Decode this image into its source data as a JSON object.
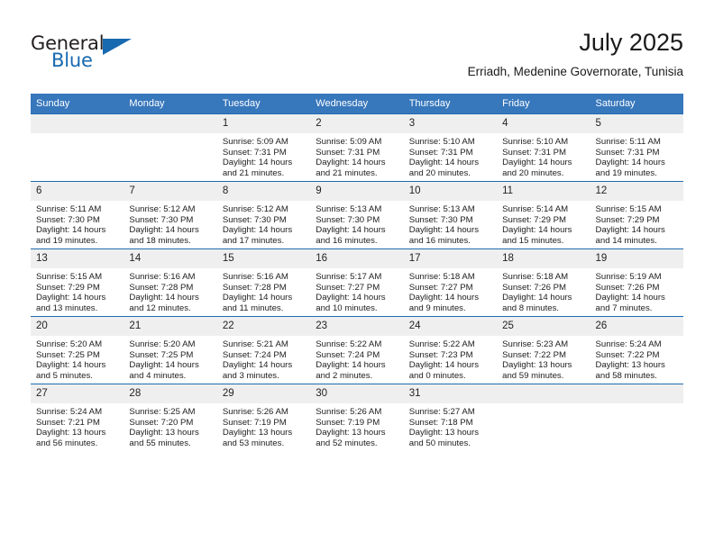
{
  "logo": {
    "line1": "General",
    "line2": "Blue",
    "triangle_icon": "triangle-icon",
    "color_text": "#231f20",
    "color_blue": "#1769b0"
  },
  "header": {
    "title": "July 2025",
    "subtitle": "Erriadh, Medenine Governorate, Tunisia"
  },
  "theme": {
    "header_bg": "#3777bc",
    "row_divider": "#1f6cb0",
    "daynum_bg": "#efefef",
    "text": "#1d1d1d"
  },
  "calendar": {
    "weekday_headers": [
      "Sunday",
      "Monday",
      "Tuesday",
      "Wednesday",
      "Thursday",
      "Friday",
      "Saturday"
    ],
    "labels": {
      "sunrise": "Sunrise:",
      "sunset": "Sunset:",
      "daylight": "Daylight:"
    },
    "weeks": [
      [
        {
          "day": ""
        },
        {
          "day": ""
        },
        {
          "day": "1",
          "sunrise": "Sunrise: 5:09 AM",
          "sunset": "Sunset: 7:31 PM",
          "daylight": "Daylight: 14 hours and 21 minutes."
        },
        {
          "day": "2",
          "sunrise": "Sunrise: 5:09 AM",
          "sunset": "Sunset: 7:31 PM",
          "daylight": "Daylight: 14 hours and 21 minutes."
        },
        {
          "day": "3",
          "sunrise": "Sunrise: 5:10 AM",
          "sunset": "Sunset: 7:31 PM",
          "daylight": "Daylight: 14 hours and 20 minutes."
        },
        {
          "day": "4",
          "sunrise": "Sunrise: 5:10 AM",
          "sunset": "Sunset: 7:31 PM",
          "daylight": "Daylight: 14 hours and 20 minutes."
        },
        {
          "day": "5",
          "sunrise": "Sunrise: 5:11 AM",
          "sunset": "Sunset: 7:31 PM",
          "daylight": "Daylight: 14 hours and 19 minutes."
        }
      ],
      [
        {
          "day": "6",
          "sunrise": "Sunrise: 5:11 AM",
          "sunset": "Sunset: 7:30 PM",
          "daylight": "Daylight: 14 hours and 19 minutes."
        },
        {
          "day": "7",
          "sunrise": "Sunrise: 5:12 AM",
          "sunset": "Sunset: 7:30 PM",
          "daylight": "Daylight: 14 hours and 18 minutes."
        },
        {
          "day": "8",
          "sunrise": "Sunrise: 5:12 AM",
          "sunset": "Sunset: 7:30 PM",
          "daylight": "Daylight: 14 hours and 17 minutes."
        },
        {
          "day": "9",
          "sunrise": "Sunrise: 5:13 AM",
          "sunset": "Sunset: 7:30 PM",
          "daylight": "Daylight: 14 hours and 16 minutes."
        },
        {
          "day": "10",
          "sunrise": "Sunrise: 5:13 AM",
          "sunset": "Sunset: 7:30 PM",
          "daylight": "Daylight: 14 hours and 16 minutes."
        },
        {
          "day": "11",
          "sunrise": "Sunrise: 5:14 AM",
          "sunset": "Sunset: 7:29 PM",
          "daylight": "Daylight: 14 hours and 15 minutes."
        },
        {
          "day": "12",
          "sunrise": "Sunrise: 5:15 AM",
          "sunset": "Sunset: 7:29 PM",
          "daylight": "Daylight: 14 hours and 14 minutes."
        }
      ],
      [
        {
          "day": "13",
          "sunrise": "Sunrise: 5:15 AM",
          "sunset": "Sunset: 7:29 PM",
          "daylight": "Daylight: 14 hours and 13 minutes."
        },
        {
          "day": "14",
          "sunrise": "Sunrise: 5:16 AM",
          "sunset": "Sunset: 7:28 PM",
          "daylight": "Daylight: 14 hours and 12 minutes."
        },
        {
          "day": "15",
          "sunrise": "Sunrise: 5:16 AM",
          "sunset": "Sunset: 7:28 PM",
          "daylight": "Daylight: 14 hours and 11 minutes."
        },
        {
          "day": "16",
          "sunrise": "Sunrise: 5:17 AM",
          "sunset": "Sunset: 7:27 PM",
          "daylight": "Daylight: 14 hours and 10 minutes."
        },
        {
          "day": "17",
          "sunrise": "Sunrise: 5:18 AM",
          "sunset": "Sunset: 7:27 PM",
          "daylight": "Daylight: 14 hours and 9 minutes."
        },
        {
          "day": "18",
          "sunrise": "Sunrise: 5:18 AM",
          "sunset": "Sunset: 7:26 PM",
          "daylight": "Daylight: 14 hours and 8 minutes."
        },
        {
          "day": "19",
          "sunrise": "Sunrise: 5:19 AM",
          "sunset": "Sunset: 7:26 PM",
          "daylight": "Daylight: 14 hours and 7 minutes."
        }
      ],
      [
        {
          "day": "20",
          "sunrise": "Sunrise: 5:20 AM",
          "sunset": "Sunset: 7:25 PM",
          "daylight": "Daylight: 14 hours and 5 minutes."
        },
        {
          "day": "21",
          "sunrise": "Sunrise: 5:20 AM",
          "sunset": "Sunset: 7:25 PM",
          "daylight": "Daylight: 14 hours and 4 minutes."
        },
        {
          "day": "22",
          "sunrise": "Sunrise: 5:21 AM",
          "sunset": "Sunset: 7:24 PM",
          "daylight": "Daylight: 14 hours and 3 minutes."
        },
        {
          "day": "23",
          "sunrise": "Sunrise: 5:22 AM",
          "sunset": "Sunset: 7:24 PM",
          "daylight": "Daylight: 14 hours and 2 minutes."
        },
        {
          "day": "24",
          "sunrise": "Sunrise: 5:22 AM",
          "sunset": "Sunset: 7:23 PM",
          "daylight": "Daylight: 14 hours and 0 minutes."
        },
        {
          "day": "25",
          "sunrise": "Sunrise: 5:23 AM",
          "sunset": "Sunset: 7:22 PM",
          "daylight": "Daylight: 13 hours and 59 minutes."
        },
        {
          "day": "26",
          "sunrise": "Sunrise: 5:24 AM",
          "sunset": "Sunset: 7:22 PM",
          "daylight": "Daylight: 13 hours and 58 minutes."
        }
      ],
      [
        {
          "day": "27",
          "sunrise": "Sunrise: 5:24 AM",
          "sunset": "Sunset: 7:21 PM",
          "daylight": "Daylight: 13 hours and 56 minutes."
        },
        {
          "day": "28",
          "sunrise": "Sunrise: 5:25 AM",
          "sunset": "Sunset: 7:20 PM",
          "daylight": "Daylight: 13 hours and 55 minutes."
        },
        {
          "day": "29",
          "sunrise": "Sunrise: 5:26 AM",
          "sunset": "Sunset: 7:19 PM",
          "daylight": "Daylight: 13 hours and 53 minutes."
        },
        {
          "day": "30",
          "sunrise": "Sunrise: 5:26 AM",
          "sunset": "Sunset: 7:19 PM",
          "daylight": "Daylight: 13 hours and 52 minutes."
        },
        {
          "day": "31",
          "sunrise": "Sunrise: 5:27 AM",
          "sunset": "Sunset: 7:18 PM",
          "daylight": "Daylight: 13 hours and 50 minutes."
        },
        {
          "day": ""
        },
        {
          "day": ""
        }
      ]
    ]
  }
}
